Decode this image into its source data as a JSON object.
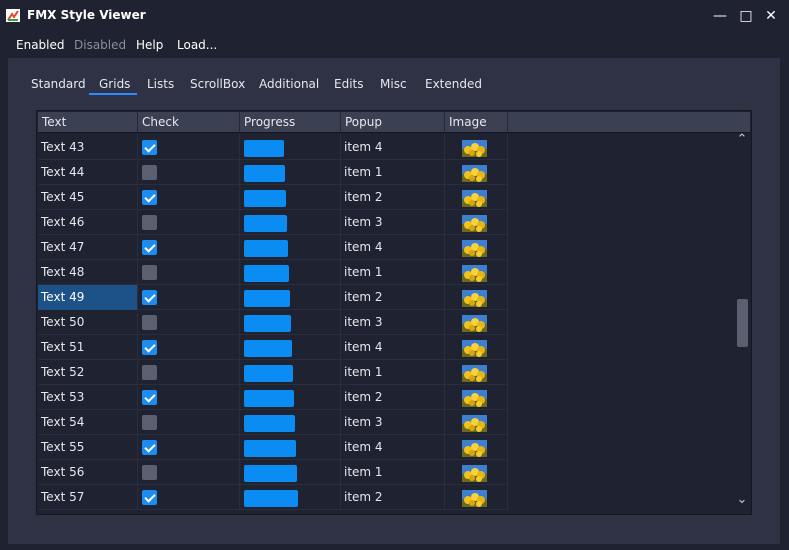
{
  "window": {
    "title": "FMX Style Viewer",
    "controls": {
      "minimize": "—",
      "maximize": "□",
      "close": "✕"
    }
  },
  "menu": {
    "items": [
      {
        "label": "Enabled",
        "enabled": true
      },
      {
        "label": "Disabled",
        "enabled": false
      },
      {
        "label": "Help",
        "enabled": true
      },
      {
        "label": "Load...",
        "enabled": true
      }
    ]
  },
  "tabs": [
    {
      "label": "Standard"
    },
    {
      "label": "Grids",
      "active": true
    },
    {
      "label": "Lists"
    },
    {
      "label": "ScrollBox"
    },
    {
      "label": "Additional"
    },
    {
      "label": "Edits"
    },
    {
      "label": "Misc"
    },
    {
      "label": "Extended"
    }
  ],
  "grid": {
    "columns": [
      "Text",
      "Check",
      "Progress",
      "Popup",
      "Image"
    ],
    "selected_row": "Text 49",
    "rows": [
      {
        "text": "Text 43",
        "checked": true,
        "progress": 0.4,
        "popup": "item 4"
      },
      {
        "text": "Text 44",
        "checked": false,
        "progress": 0.41,
        "popup": "item 1"
      },
      {
        "text": "Text 45",
        "checked": true,
        "progress": 0.42,
        "popup": "item 2"
      },
      {
        "text": "Text 46",
        "checked": false,
        "progress": 0.43,
        "popup": "item 3"
      },
      {
        "text": "Text 47",
        "checked": true,
        "progress": 0.44,
        "popup": "item 4"
      },
      {
        "text": "Text 48",
        "checked": false,
        "progress": 0.45,
        "popup": "item 1"
      },
      {
        "text": "Text 49",
        "checked": true,
        "progress": 0.46,
        "popup": "item 2"
      },
      {
        "text": "Text 50",
        "checked": false,
        "progress": 0.47,
        "popup": "item 3"
      },
      {
        "text": "Text 51",
        "checked": true,
        "progress": 0.48,
        "popup": "item 4"
      },
      {
        "text": "Text 52",
        "checked": false,
        "progress": 0.49,
        "popup": "item 1"
      },
      {
        "text": "Text 53",
        "checked": true,
        "progress": 0.5,
        "popup": "item 2"
      },
      {
        "text": "Text 54",
        "checked": false,
        "progress": 0.51,
        "popup": "item 3"
      },
      {
        "text": "Text 55",
        "checked": true,
        "progress": 0.52,
        "popup": "item 4"
      },
      {
        "text": "Text 56",
        "checked": false,
        "progress": 0.53,
        "popup": "item 1"
      },
      {
        "text": "Text 57",
        "checked": true,
        "progress": 0.54,
        "popup": "item 2"
      }
    ]
  },
  "colors": {
    "accent": "#2b8cff",
    "progress": "#0b8cf2",
    "selection": "#1d5288",
    "window_bg": "#1f2230",
    "panel_bg": "#2e3244"
  },
  "icons": {
    "app": "app-icon",
    "row_image": "yellow-flowers-image-icon",
    "scroll_up": "chevron-up-icon",
    "scroll_down": "chevron-down-icon"
  }
}
